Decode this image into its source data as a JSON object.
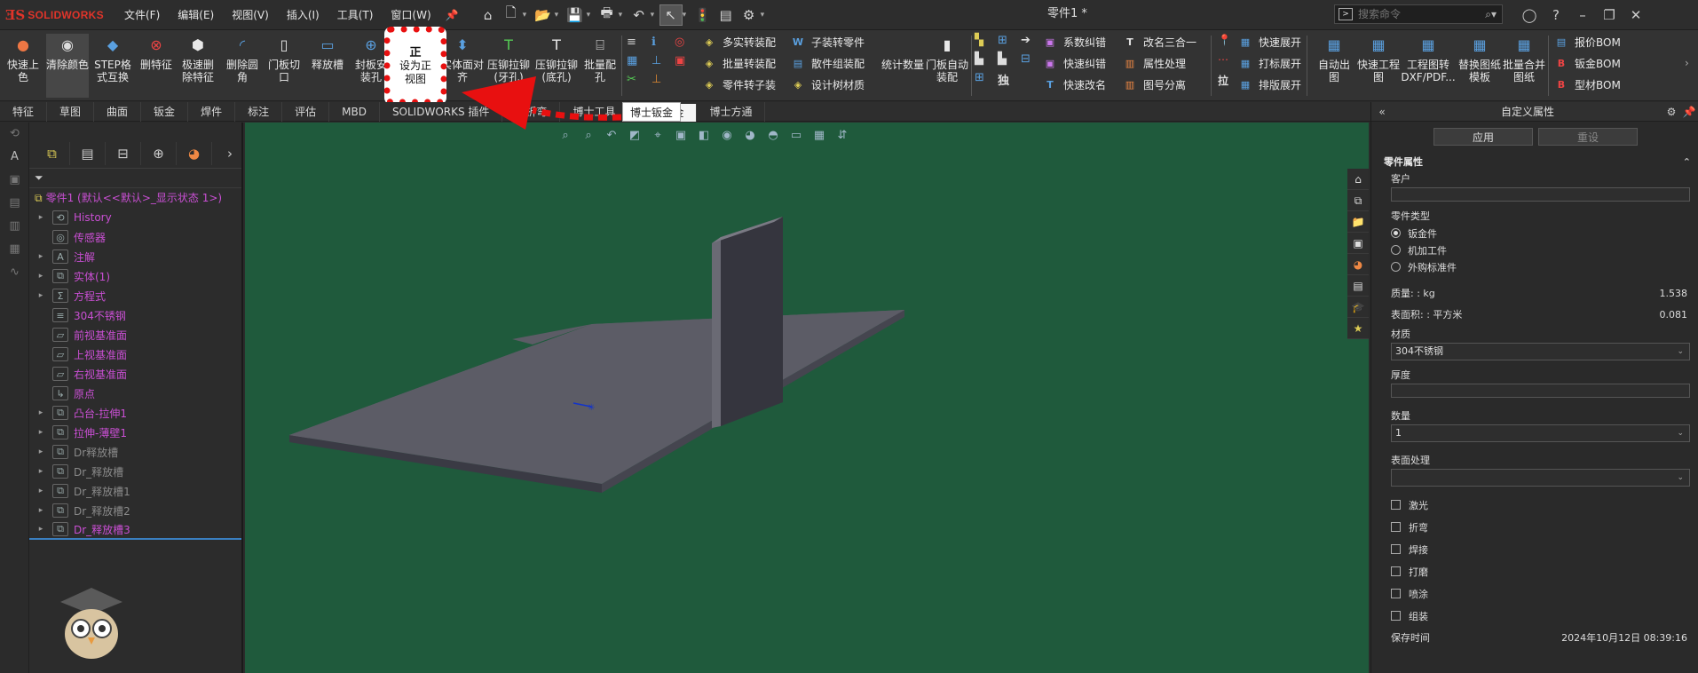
{
  "app": {
    "logo_mark": "ƎS",
    "logo_text": "SOLIDWORKS",
    "document_title": "零件1 *"
  },
  "menu": [
    "文件(F)",
    "编辑(E)",
    "视图(V)",
    "插入(I)",
    "工具(T)",
    "窗口(W)"
  ],
  "search": {
    "placeholder": "搜索命令"
  },
  "ribbon": {
    "big_buttons": [
      "快速上色",
      "清除颜色",
      "STEP格式互换",
      "删特征",
      "极速删除特征",
      "删除圆角",
      "门板切口",
      "释放槽",
      "封板安装孔",
      "实体面对齐",
      "压铆拉铆(牙孔)",
      "压铆拉铆(底孔)",
      "批量配孔"
    ],
    "small_col1": [
      "多实转装配",
      "批量转装配",
      "零件转子装"
    ],
    "small_col2": [
      "子装转零件",
      "散件组装配",
      "设计树材质"
    ],
    "big_buttons2": [
      "统计数量",
      "门板自动装配"
    ],
    "small_col3": [
      "系数纠错",
      "快速纠错",
      "快速改名"
    ],
    "small_col4": [
      "改名三合一",
      "属性处理",
      "图号分离"
    ],
    "small_col5": [
      "快速展开",
      "打标展开",
      "排版展开"
    ],
    "big_buttons3": [
      "自动出图",
      "快速工程图",
      "工程图转DXF/PDF...",
      "替换图纸模板",
      "批量合并图纸"
    ],
    "small_col6": [
      "报价BOM",
      "钣金BOM",
      "型材BOM"
    ],
    "small_glyphs": [
      "独",
      "拉"
    ]
  },
  "callout": {
    "big": "正",
    "label": "设为正视图"
  },
  "tabs": [
    "特征",
    "草图",
    "曲面",
    "钣金",
    "焊件",
    "标注",
    "评估",
    "MBD",
    "SOLIDWORKS 插件",
    "创折弯",
    "博士工具",
    "博士钣金",
    "博士方通"
  ],
  "active_tab": "博士钣金",
  "tooltip": "博士钣金",
  "tree": {
    "root": "零件1 (默认<<默认>_显示状态 1>)",
    "items": [
      {
        "label": "History",
        "grey": false,
        "exp": true
      },
      {
        "label": "传感器",
        "grey": false,
        "exp": false
      },
      {
        "label": "注解",
        "grey": false,
        "exp": true
      },
      {
        "label": "实体(1)",
        "grey": false,
        "exp": true
      },
      {
        "label": "方程式",
        "grey": false,
        "exp": true
      },
      {
        "label": "304不锈钢",
        "grey": false,
        "exp": false
      },
      {
        "label": "前视基准面",
        "grey": false,
        "exp": false
      },
      {
        "label": "上视基准面",
        "grey": false,
        "exp": false
      },
      {
        "label": "右视基准面",
        "grey": false,
        "exp": false
      },
      {
        "label": "原点",
        "grey": false,
        "exp": false
      },
      {
        "label": "凸台-拉伸1",
        "grey": false,
        "exp": true
      },
      {
        "label": "拉伸-薄壁1",
        "grey": false,
        "exp": true
      },
      {
        "label": "Dr释放槽",
        "grey": true,
        "exp": true
      },
      {
        "label": "Dr_释放槽",
        "grey": true,
        "exp": true
      },
      {
        "label": "Dr_释放槽1",
        "grey": true,
        "exp": true
      },
      {
        "label": "Dr_释放槽2",
        "grey": true,
        "exp": true
      },
      {
        "label": "Dr_释放槽3",
        "grey": false,
        "exp": true
      }
    ]
  },
  "props": {
    "title": "自定义属性",
    "apply": "应用",
    "reset": "重设",
    "section": "零件属性",
    "customer_label": "客户",
    "part_type_label": "零件类型",
    "part_types": [
      "钣金件",
      "机加工件",
      "外购标准件"
    ],
    "mass_label": "质量: : kg",
    "mass_value": "1.538",
    "area_label": "表面积: : 平方米",
    "area_value": "0.081",
    "material_label": "材质",
    "material_value": "304不锈钢",
    "thickness_label": "厚度",
    "quantity_label": "数量",
    "quantity_value": "1",
    "surface_label": "表面处理",
    "checks": [
      "激光",
      "折弯",
      "焊接",
      "打磨",
      "喷涂",
      "组装"
    ],
    "save_time_label": "保存时间",
    "save_time_value": "2024年10月12日 08:39:16"
  },
  "colors": {
    "viewport": "#1f5a3c",
    "callout_border": "#e81010",
    "tree_text": "#c94fd3",
    "model": "#5b5b66"
  }
}
